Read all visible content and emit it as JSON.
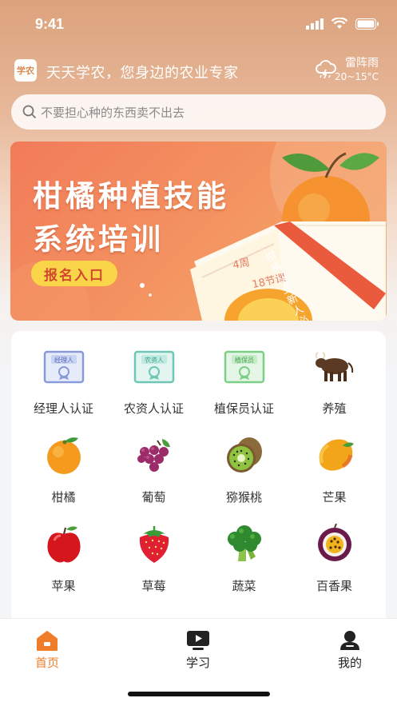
{
  "status_bar": {
    "time": "9:41"
  },
  "header": {
    "logo_text": "学农",
    "slogan": "天天学农，您身边的农业专家",
    "weather": {
      "condition": "雷阵雨",
      "temperature": "20~15°C",
      "icon": "thunderstorm-icon"
    }
  },
  "search": {
    "placeholder": "不要担心种的东西卖不出去",
    "icon": "search-icon"
  },
  "banner": {
    "title_line1": "柑橘种植技能",
    "title_line2": "系统培训",
    "button_label": "报名入口",
    "book_week": "4周",
    "book_lessons": "18节课",
    "ribbon_text": "柑橘从业新人必看宝典"
  },
  "categories": [
    {
      "label": "经理人认证",
      "icon": "manager-certificate-icon"
    },
    {
      "label": "农资人认证",
      "icon": "agri-supplier-certificate-icon"
    },
    {
      "label": "植保员认证",
      "icon": "plant-protector-certificate-icon"
    },
    {
      "label": "养殖",
      "icon": "cattle-icon"
    },
    {
      "label": "柑橘",
      "icon": "orange-icon"
    },
    {
      "label": "葡萄",
      "icon": "grape-icon"
    },
    {
      "label": "猕猴桃",
      "icon": "kiwi-icon"
    },
    {
      "label": "芒果",
      "icon": "mango-icon"
    },
    {
      "label": "苹果",
      "icon": "apple-icon"
    },
    {
      "label": "草莓",
      "icon": "strawberry-icon"
    },
    {
      "label": "蔬菜",
      "icon": "broccoli-icon"
    },
    {
      "label": "百香果",
      "icon": "passion-fruit-icon"
    }
  ],
  "cert_badges": [
    "经理人",
    "农资人",
    "植保员"
  ],
  "tabbar": [
    {
      "label": "首页",
      "icon": "home-icon",
      "active": true
    },
    {
      "label": "学习",
      "icon": "video-play-icon",
      "active": false
    },
    {
      "label": "我的",
      "icon": "user-icon",
      "active": false
    }
  ],
  "colors": {
    "accent": "#f07d2a",
    "banner": "#f27b5a",
    "badge_yellow": "#fbd549"
  }
}
